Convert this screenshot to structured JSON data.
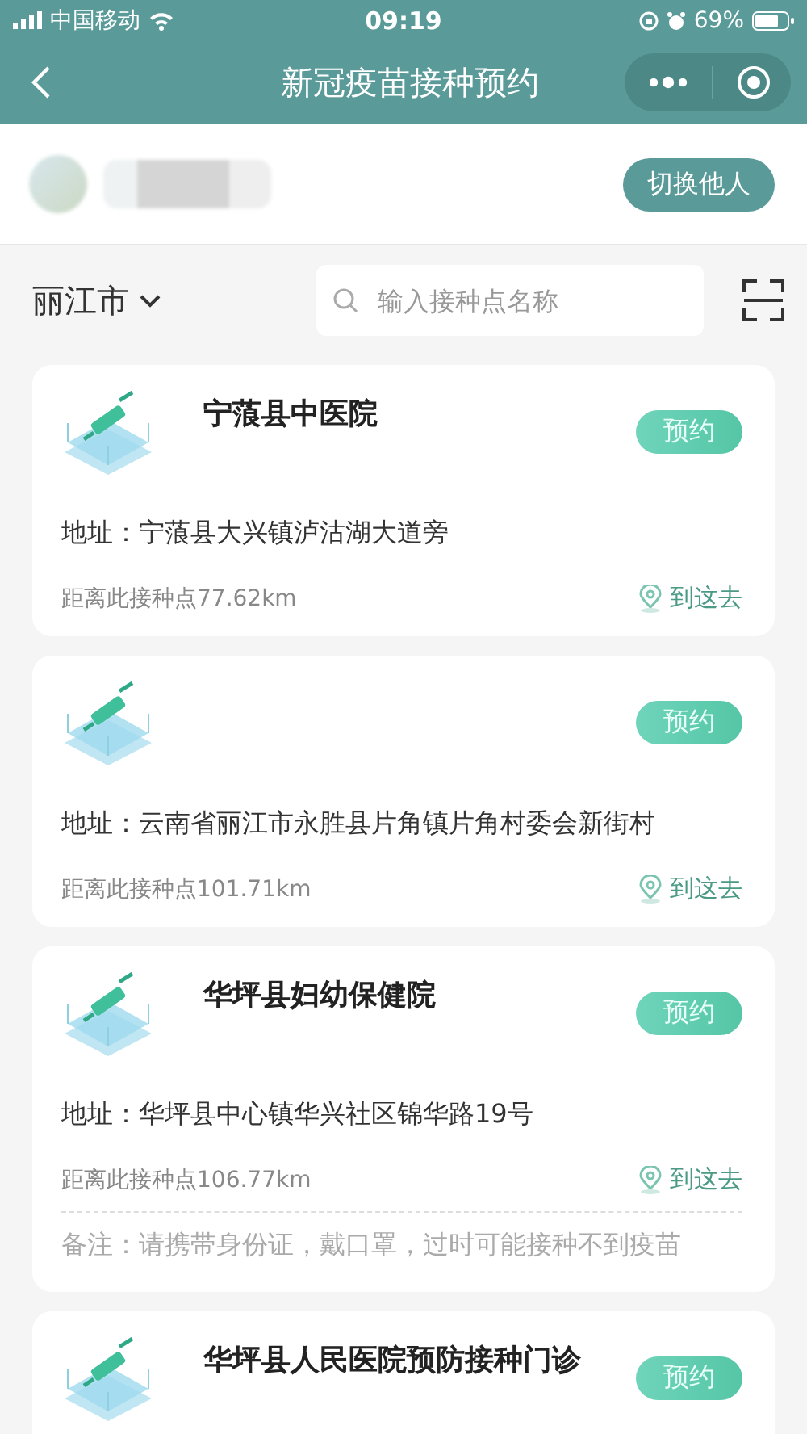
{
  "status_bar": {
    "carrier": "中国移动",
    "time": "09:19",
    "battery": "69%"
  },
  "nav": {
    "title": "新冠疫苗接种预约"
  },
  "profile": {
    "switch_button": "切换他人"
  },
  "filter": {
    "city": "丽江市",
    "search": {
      "placeholder": "输入接种点名称"
    }
  },
  "sites": [
    {
      "name": "宁蒗县中医院",
      "reserve": "预约",
      "address": "地址：宁蒗县大兴镇泸沽湖大道旁",
      "distance": "距离此接种点77.62km",
      "navigate": "到这去"
    },
    {
      "reserve": "预约",
      "address": "地址：云南省丽江市永胜县片角镇片角村委会新街村",
      "distance": "距离此接种点101.71km",
      "navigate": "到这去"
    },
    {
      "name": "华坪县妇幼保健院",
      "reserve": "预约",
      "address": "地址：华坪县中心镇华兴社区锦华路19号",
      "distance": "距离此接种点106.77km",
      "navigate": "到这去",
      "note": "备注：请携带身份证，戴口罩，过时可能接种不到疫苗"
    },
    {
      "name": "华坪县人民医院预防接种门诊",
      "reserve": "预约"
    }
  ]
}
